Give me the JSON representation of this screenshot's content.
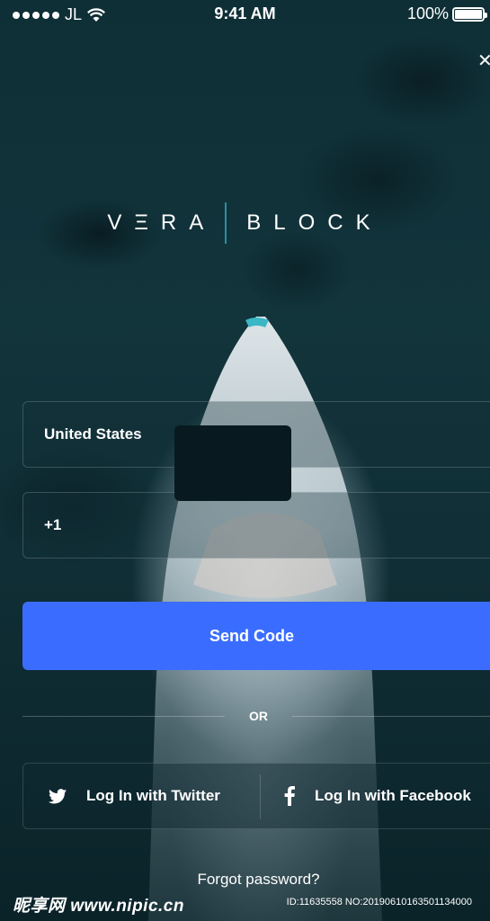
{
  "status_bar": {
    "carrier": "JL",
    "time": "9:41 AM",
    "battery": "100%"
  },
  "logo": {
    "left": "VΞRA",
    "right": "BLOCK"
  },
  "form": {
    "country_value": "United States",
    "phone_prefix": "+1",
    "send_code_label": "Send Code"
  },
  "divider_text": "OR",
  "social": {
    "twitter_label": "Log In with Twitter",
    "facebook_label": "Log In with Facebook"
  },
  "forgot_password": "Forgot password?",
  "watermark": {
    "site": "昵享网 www.nipic.cn",
    "id": "ID:11635558 NO:20190610163501134000"
  },
  "colors": {
    "accent": "#3a6dff",
    "logo_divider": "#2c8ea0",
    "background": "#12343b"
  },
  "icons": [
    "wifi-icon",
    "battery-icon",
    "close-icon",
    "twitter-icon",
    "facebook-icon"
  ]
}
